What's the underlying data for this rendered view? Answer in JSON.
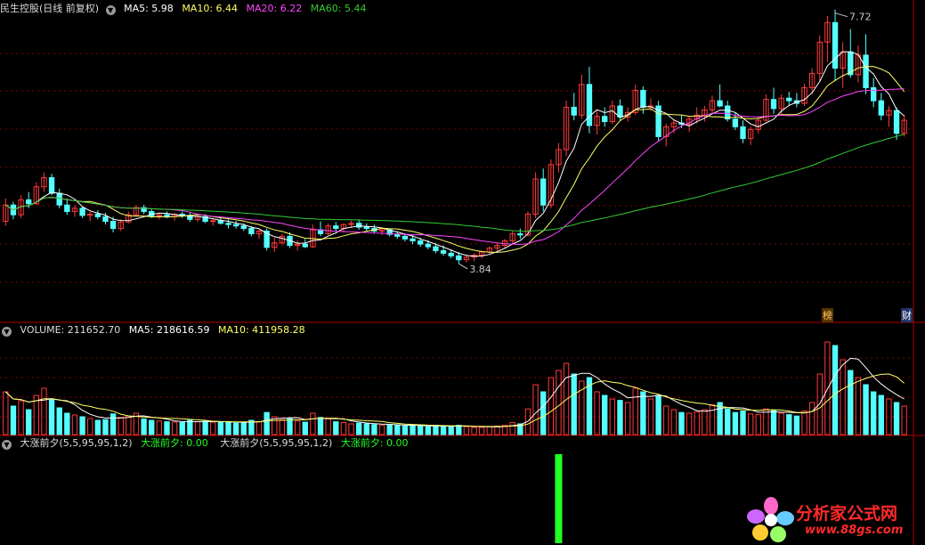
{
  "colors": {
    "up": "#ff3a3a",
    "down": "#54ffff",
    "ma5": "#ffffff",
    "ma10": "#ffff66",
    "ma20": "#ff44ff",
    "ma60": "#33cc33",
    "grid": "#8a0000",
    "signal": "#22ff22"
  },
  "price_panel": {
    "title": "民生控股(日线 前复权)",
    "ma5": "MA5: 5.98",
    "ma10": "MA10: 6.44",
    "ma20": "MA20: 6.22",
    "ma60": "MA60: 5.44",
    "high_label": "7.72",
    "low_label": "3.84",
    "tag_bang": "榜",
    "tag_cai": "财"
  },
  "volume_panel": {
    "volume": "VOLUME: 211652.70",
    "ma5": "MA5: 218616.59",
    "ma10": "MA10: 411958.28"
  },
  "indicator_panel": {
    "name1": "大涨前夕(5,5,95,95,1,2)",
    "val1": "大涨前夕: 0.00",
    "name2": "大涨前夕(5,5,95,95,1,2)",
    "val2": "大涨前夕: 0.00"
  },
  "logo": {
    "text": "分析家公式网",
    "url": "www.88gs.com"
  },
  "chart_data": {
    "type": "candlestick",
    "ylim": [
      3.6,
      8.0
    ],
    "signal_index": 72,
    "bars": [
      [
        4.85,
        5.2,
        4.78,
        5.1,
        120
      ],
      [
        5.1,
        5.15,
        4.88,
        4.95,
        80
      ],
      [
        4.95,
        5.25,
        4.9,
        5.18,
        95
      ],
      [
        5.18,
        5.3,
        5.05,
        5.12,
        70
      ],
      [
        5.12,
        5.45,
        5.1,
        5.38,
        110
      ],
      [
        5.38,
        5.6,
        5.3,
        5.52,
        130
      ],
      [
        5.52,
        5.58,
        5.25,
        5.28,
        100
      ],
      [
        5.28,
        5.35,
        5.05,
        5.1,
        75
      ],
      [
        5.1,
        5.2,
        4.95,
        5.0,
        60
      ],
      [
        5.0,
        5.1,
        4.92,
        5.05,
        55
      ],
      [
        5.05,
        5.08,
        4.9,
        4.94,
        50
      ],
      [
        4.94,
        5.0,
        4.85,
        4.96,
        45
      ],
      [
        4.96,
        5.02,
        4.88,
        4.92,
        40
      ],
      [
        4.92,
        4.98,
        4.8,
        4.85,
        42
      ],
      [
        4.85,
        4.92,
        4.68,
        4.74,
        58
      ],
      [
        4.74,
        4.88,
        4.7,
        4.84,
        48
      ],
      [
        4.84,
        5.0,
        4.82,
        4.95,
        52
      ],
      [
        4.95,
        5.1,
        4.92,
        5.06,
        60
      ],
      [
        5.06,
        5.1,
        4.96,
        5.0,
        44
      ],
      [
        5.0,
        5.04,
        4.9,
        4.93,
        40
      ],
      [
        4.93,
        4.98,
        4.88,
        4.95,
        38
      ],
      [
        4.95,
        5.0,
        4.9,
        4.92,
        36
      ],
      [
        4.92,
        4.98,
        4.86,
        4.96,
        35
      ],
      [
        4.96,
        5.0,
        4.9,
        4.94,
        34
      ],
      [
        4.94,
        4.98,
        4.84,
        4.88,
        40
      ],
      [
        4.88,
        4.95,
        4.84,
        4.92,
        36
      ],
      [
        4.92,
        4.96,
        4.82,
        4.85,
        38
      ],
      [
        4.85,
        4.9,
        4.78,
        4.86,
        35
      ],
      [
        4.86,
        4.92,
        4.8,
        4.82,
        34
      ],
      [
        4.82,
        4.88,
        4.74,
        4.8,
        36
      ],
      [
        4.8,
        4.86,
        4.74,
        4.78,
        32
      ],
      [
        4.78,
        4.82,
        4.7,
        4.74,
        34
      ],
      [
        4.74,
        4.78,
        4.62,
        4.66,
        40
      ],
      [
        4.66,
        4.72,
        4.58,
        4.7,
        36
      ],
      [
        4.7,
        4.74,
        4.4,
        4.45,
        62
      ],
      [
        4.45,
        4.6,
        4.38,
        4.52,
        50
      ],
      [
        4.52,
        4.66,
        4.48,
        4.62,
        42
      ],
      [
        4.62,
        4.68,
        4.44,
        4.48,
        46
      ],
      [
        4.48,
        4.56,
        4.4,
        4.5,
        38
      ],
      [
        4.5,
        4.58,
        4.44,
        4.46,
        35
      ],
      [
        4.46,
        4.8,
        4.44,
        4.72,
        60
      ],
      [
        4.72,
        4.85,
        4.62,
        4.66,
        48
      ],
      [
        4.66,
        4.82,
        4.64,
        4.78,
        44
      ],
      [
        4.78,
        4.84,
        4.7,
        4.74,
        36
      ],
      [
        4.74,
        4.82,
        4.68,
        4.8,
        34
      ],
      [
        4.8,
        4.86,
        4.76,
        4.82,
        30
      ],
      [
        4.82,
        4.88,
        4.72,
        4.76,
        32
      ],
      [
        4.76,
        4.82,
        4.7,
        4.74,
        30
      ],
      [
        4.74,
        4.8,
        4.66,
        4.7,
        28
      ],
      [
        4.7,
        4.76,
        4.64,
        4.72,
        26
      ],
      [
        4.72,
        4.74,
        4.62,
        4.65,
        28
      ],
      [
        4.65,
        4.7,
        4.58,
        4.62,
        26
      ],
      [
        4.62,
        4.66,
        4.54,
        4.58,
        24
      ],
      [
        4.58,
        4.64,
        4.5,
        4.55,
        26
      ],
      [
        4.55,
        4.6,
        4.46,
        4.5,
        24
      ],
      [
        4.5,
        4.56,
        4.42,
        4.46,
        22
      ],
      [
        4.46,
        4.52,
        4.36,
        4.4,
        26
      ],
      [
        4.4,
        4.48,
        4.32,
        4.36,
        22
      ],
      [
        4.36,
        4.42,
        4.28,
        4.32,
        24
      ],
      [
        4.32,
        4.38,
        4.2,
        4.26,
        26
      ],
      [
        4.26,
        4.34,
        4.22,
        4.3,
        22
      ],
      [
        4.3,
        4.36,
        4.24,
        4.33,
        20
      ],
      [
        4.33,
        4.4,
        4.28,
        4.38,
        20
      ],
      [
        4.38,
        4.46,
        4.34,
        4.44,
        22
      ],
      [
        4.44,
        4.52,
        4.4,
        4.48,
        24
      ],
      [
        4.48,
        4.58,
        4.44,
        4.55,
        26
      ],
      [
        4.55,
        4.7,
        4.5,
        4.66,
        34
      ],
      [
        4.66,
        4.74,
        4.58,
        4.64,
        30
      ],
      [
        4.64,
        5.0,
        4.62,
        4.96,
        72
      ],
      [
        4.96,
        5.6,
        4.9,
        5.5,
        140
      ],
      [
        5.5,
        5.66,
        5.0,
        5.1,
        120
      ],
      [
        5.1,
        5.8,
        5.05,
        5.72,
        160
      ],
      [
        5.72,
        6.05,
        5.6,
        5.95,
        180
      ],
      [
        5.95,
        6.7,
        5.85,
        6.6,
        200
      ],
      [
        6.6,
        6.82,
        6.4,
        6.48,
        170
      ],
      [
        6.48,
        7.1,
        6.42,
        6.95,
        150
      ],
      [
        6.95,
        7.22,
        6.2,
        6.32,
        160
      ],
      [
        6.32,
        6.55,
        6.18,
        6.46,
        120
      ],
      [
        6.46,
        6.6,
        6.3,
        6.38,
        110
      ],
      [
        6.38,
        6.7,
        6.34,
        6.62,
        100
      ],
      [
        6.62,
        6.72,
        6.4,
        6.45,
        96
      ],
      [
        6.45,
        6.6,
        6.38,
        6.52,
        90
      ],
      [
        6.52,
        6.95,
        6.48,
        6.86,
        130
      ],
      [
        6.86,
        6.92,
        6.5,
        6.6,
        120
      ],
      [
        6.6,
        6.74,
        6.54,
        6.62,
        100
      ],
      [
        6.62,
        6.7,
        6.08,
        6.15,
        110
      ],
      [
        6.15,
        6.35,
        6.0,
        6.3,
        80
      ],
      [
        6.3,
        6.42,
        6.2,
        6.36,
        70
      ],
      [
        6.36,
        6.48,
        6.28,
        6.34,
        62
      ],
      [
        6.34,
        6.46,
        6.22,
        6.42,
        60
      ],
      [
        6.42,
        6.6,
        6.35,
        6.48,
        64
      ],
      [
        6.48,
        6.62,
        6.38,
        6.56,
        70
      ],
      [
        6.56,
        6.78,
        6.5,
        6.7,
        84
      ],
      [
        6.7,
        6.95,
        6.6,
        6.62,
        90
      ],
      [
        6.62,
        6.7,
        6.38,
        6.42,
        72
      ],
      [
        6.42,
        6.52,
        6.25,
        6.3,
        62
      ],
      [
        6.3,
        6.4,
        6.05,
        6.12,
        66
      ],
      [
        6.12,
        6.3,
        6.02,
        6.26,
        58
      ],
      [
        6.26,
        6.46,
        6.2,
        6.4,
        56
      ],
      [
        6.4,
        6.8,
        6.38,
        6.72,
        72
      ],
      [
        6.72,
        6.9,
        6.5,
        6.58,
        68
      ],
      [
        6.58,
        6.8,
        6.48,
        6.74,
        60
      ],
      [
        6.74,
        6.84,
        6.62,
        6.7,
        56
      ],
      [
        6.7,
        6.82,
        6.6,
        6.66,
        52
      ],
      [
        6.66,
        6.96,
        6.62,
        6.9,
        66
      ],
      [
        6.9,
        7.2,
        6.8,
        7.12,
        90
      ],
      [
        7.12,
        7.7,
        7.0,
        7.6,
        170
      ],
      [
        7.6,
        8.0,
        7.3,
        7.9,
        260
      ],
      [
        7.9,
        8.1,
        7.0,
        7.2,
        250
      ],
      [
        7.2,
        7.6,
        6.9,
        7.45,
        210
      ],
      [
        7.45,
        7.8,
        7.05,
        7.1,
        180
      ],
      [
        7.1,
        7.55,
        6.98,
        7.4,
        160
      ],
      [
        7.4,
        7.72,
        6.8,
        6.9,
        140
      ],
      [
        6.9,
        7.05,
        6.6,
        6.7,
        120
      ],
      [
        6.7,
        6.82,
        6.4,
        6.48,
        110
      ],
      [
        6.48,
        6.62,
        6.3,
        6.55,
        100
      ],
      [
        6.55,
        6.6,
        6.1,
        6.2,
        90
      ],
      [
        6.2,
        6.48,
        6.15,
        6.4,
        80
      ]
    ]
  }
}
